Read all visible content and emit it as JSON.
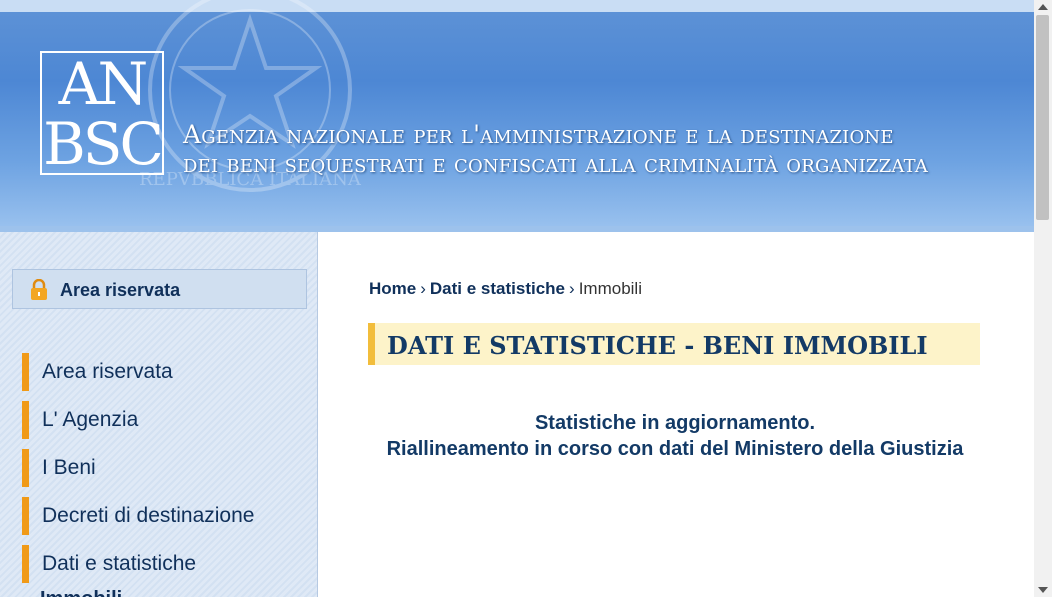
{
  "header": {
    "logo_line1": "AN",
    "logo_line2": "BSC",
    "title_line1": "Agenzia nazionale per l'amministrazione e la destinazione",
    "title_line2": "dei beni sequestrati e confiscati alla criminalità organizzata",
    "emblem_text": "REPVBBLICA ITALIANA"
  },
  "sidebar": {
    "reserved_label": "Area riservata",
    "items": [
      {
        "label": "Area riservata"
      },
      {
        "label": "L' Agenzia"
      },
      {
        "label": "I Beni"
      },
      {
        "label": "Decreti di destinazione"
      },
      {
        "label": "Dati e statistiche"
      }
    ],
    "sub_item": "Immobili"
  },
  "breadcrumb": {
    "home": "Home",
    "section": "Dati e statistiche",
    "current": "Immobili",
    "separator": "›"
  },
  "main": {
    "title": "DATI E STATISTICHE - BENI IMMOBILI",
    "notice_line1": "Statistiche in aggiornamento.",
    "notice_line2": "Riallineamento in corso con dati del Ministero della Giustizia"
  },
  "colors": {
    "accent_orange": "#f09a18",
    "title_bg": "#fdf3c9",
    "navy": "#10305a"
  }
}
